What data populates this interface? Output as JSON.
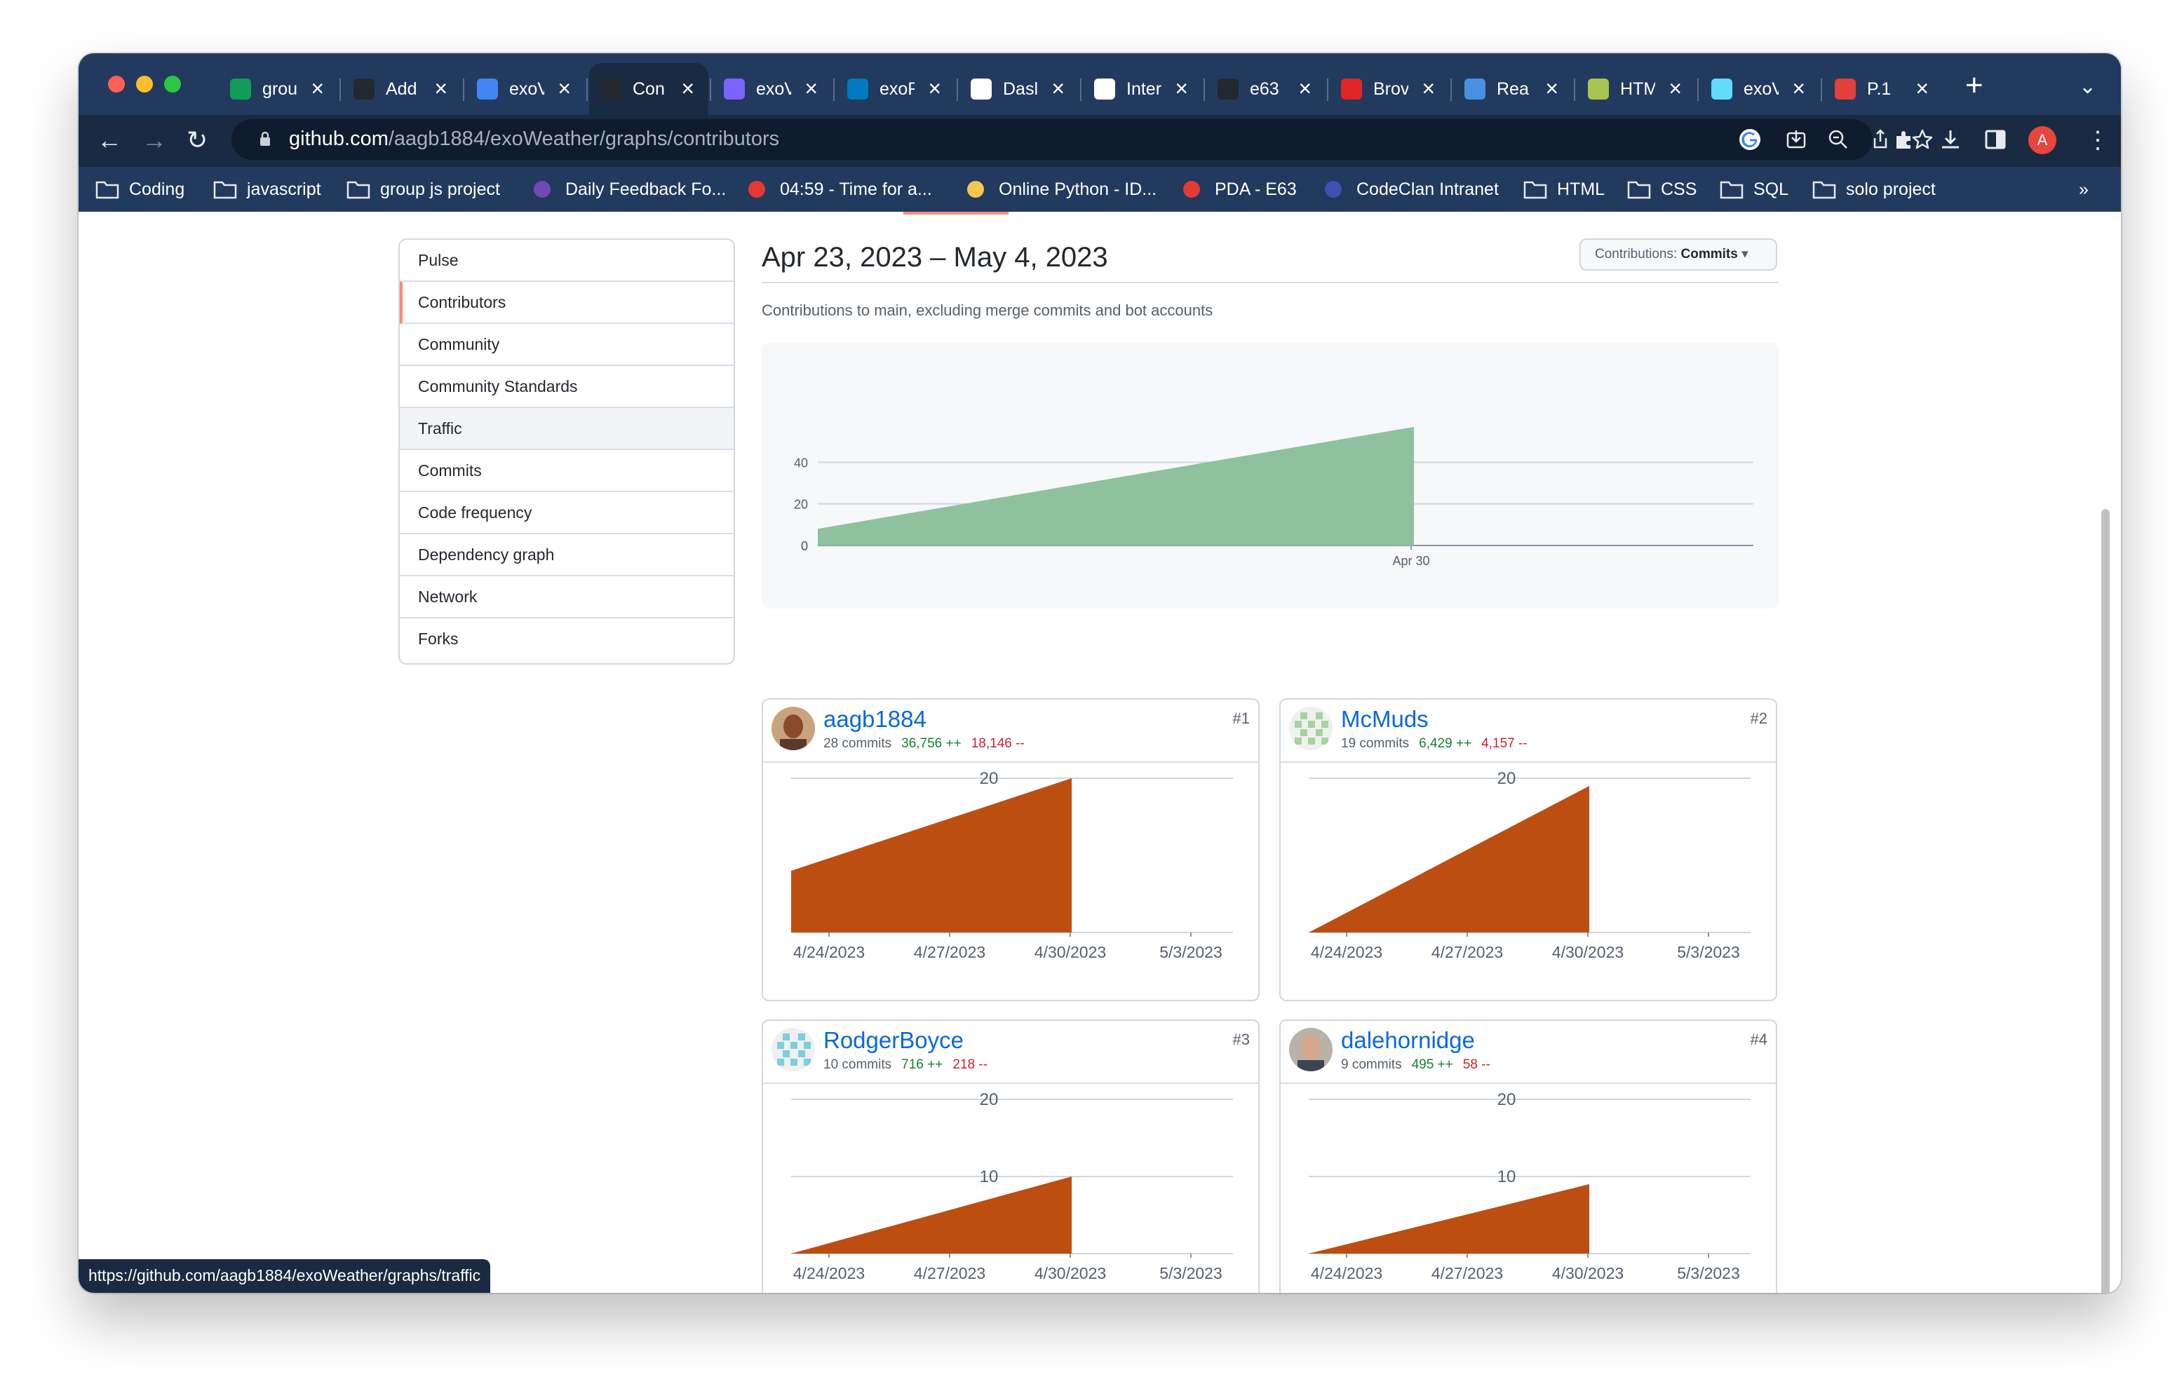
{
  "browser": {
    "tabs": [
      {
        "label": "grou",
        "icon": "google-sheets-icon",
        "color": "#0f9d58"
      },
      {
        "label": "Add",
        "icon": "github-icon",
        "color": "#24292f"
      },
      {
        "label": "exoV",
        "icon": "google-docs-icon",
        "color": "#4285f4"
      },
      {
        "label": "Con",
        "icon": "github-icon",
        "color": "#24292f"
      },
      {
        "label": "exoV",
        "icon": "app-icon",
        "color": "#7b61ff"
      },
      {
        "label": "exoF",
        "icon": "trello-icon",
        "color": "#0079bf"
      },
      {
        "label": "Dasl",
        "icon": "page-icon",
        "color": "#ffffff"
      },
      {
        "label": "Inter",
        "icon": "page-icon",
        "color": "#ffffff"
      },
      {
        "label": "e63",
        "icon": "github-icon",
        "color": "#24292f"
      },
      {
        "label": "Brov",
        "icon": "zoho-icon",
        "color": "#e42527"
      },
      {
        "label": "Rea",
        "icon": "flag-icon",
        "color": "#4a90e2"
      },
      {
        "label": "HTM",
        "icon": "app-icon",
        "color": "#a9c451"
      },
      {
        "label": "exoV",
        "icon": "react-icon",
        "color": "#61dafb"
      },
      {
        "label": "P.1",
        "icon": "app-icon",
        "color": "#e2403a"
      }
    ],
    "url_host": "github.com",
    "url_path": "/aagb1884/exoWeather/graphs/contributors",
    "profile_initial": "A",
    "bookmarks": [
      "Coding",
      "javascript",
      "group js project",
      "Daily Feedback Fo...",
      "04:59 - Time for a...",
      "Online Python - ID...",
      "PDA - E63",
      "CodeClan Intranet",
      "HTML",
      "CSS",
      "SQL",
      "solo project"
    ],
    "bookmarks_overflow": "»",
    "status_url": "https://github.com/aagb1884/exoWeather/graphs/traffic"
  },
  "sidebar": {
    "items": [
      "Pulse",
      "Contributors",
      "Community",
      "Community Standards",
      "Traffic",
      "Commits",
      "Code frequency",
      "Dependency graph",
      "Network",
      "Forks"
    ]
  },
  "header": {
    "range": "Apr 23, 2023 – May 4, 2023",
    "dropdown_prefix": "Contributions: ",
    "dropdown_value": "Commits",
    "subtitle": "Contributions to main, excluding merge commits and bot accounts"
  },
  "chart_data": [
    {
      "type": "area",
      "title": "",
      "x": [
        "2023-04-23",
        "2023-04-30"
      ],
      "y": [
        8,
        57
      ],
      "xticks": [
        "Apr 30"
      ],
      "yticks": [
        0,
        20,
        40
      ],
      "ylim": [
        0,
        60
      ],
      "color": "#8fc19e",
      "grid": true
    },
    {
      "type": "area",
      "title": "aagb1884",
      "x": [
        "4/23/2023",
        "4/30/2023"
      ],
      "y": [
        8,
        20
      ],
      "xticks": [
        "4/24/2023",
        "4/27/2023",
        "4/30/2023",
        "5/3/2023"
      ],
      "yticks": [
        20
      ],
      "ylim": [
        0,
        20
      ],
      "color": "#bd4e12",
      "grid": true
    },
    {
      "type": "area",
      "title": "McMuds",
      "x": [
        "4/23/2023",
        "4/30/2023"
      ],
      "y": [
        0,
        19
      ],
      "xticks": [
        "4/24/2023",
        "4/27/2023",
        "4/30/2023",
        "5/3/2023"
      ],
      "yticks": [
        20
      ],
      "ylim": [
        0,
        20
      ],
      "color": "#bd4e12",
      "grid": true
    },
    {
      "type": "area",
      "title": "RodgerBoyce",
      "x": [
        "4/23/2023",
        "4/30/2023"
      ],
      "y": [
        0,
        10
      ],
      "xticks": [
        "4/24/2023",
        "4/27/2023",
        "4/30/2023",
        "5/3/2023"
      ],
      "yticks": [
        10,
        20
      ],
      "ylim": [
        0,
        20
      ],
      "color": "#bd4e12",
      "grid": true
    },
    {
      "type": "area",
      "title": "dalehornidge",
      "x": [
        "4/23/2023",
        "4/30/2023"
      ],
      "y": [
        0,
        9
      ],
      "xticks": [
        "4/24/2023",
        "4/27/2023",
        "4/30/2023",
        "5/3/2023"
      ],
      "yticks": [
        10,
        20
      ],
      "ylim": [
        0,
        20
      ],
      "color": "#bd4e12",
      "grid": true
    }
  ],
  "contributors": [
    {
      "name": "aagb1884",
      "commits": "28 commits",
      "additions": "36,756 ++",
      "deletions": "18,146 --",
      "rank": "#1",
      "avatar": "photo-avatar"
    },
    {
      "name": "McMuds",
      "commits": "19 commits",
      "additions": "6,429 ++",
      "deletions": "4,157 --",
      "rank": "#2",
      "avatar": "identicon-green"
    },
    {
      "name": "RodgerBoyce",
      "commits": "10 commits",
      "additions": "716 ++",
      "deletions": "218 --",
      "rank": "#3",
      "avatar": "identicon-blue"
    },
    {
      "name": "dalehornidge",
      "commits": "9 commits",
      "additions": "495 ++",
      "deletions": "58 --",
      "rank": "#4",
      "avatar": "photo-avatar"
    }
  ]
}
